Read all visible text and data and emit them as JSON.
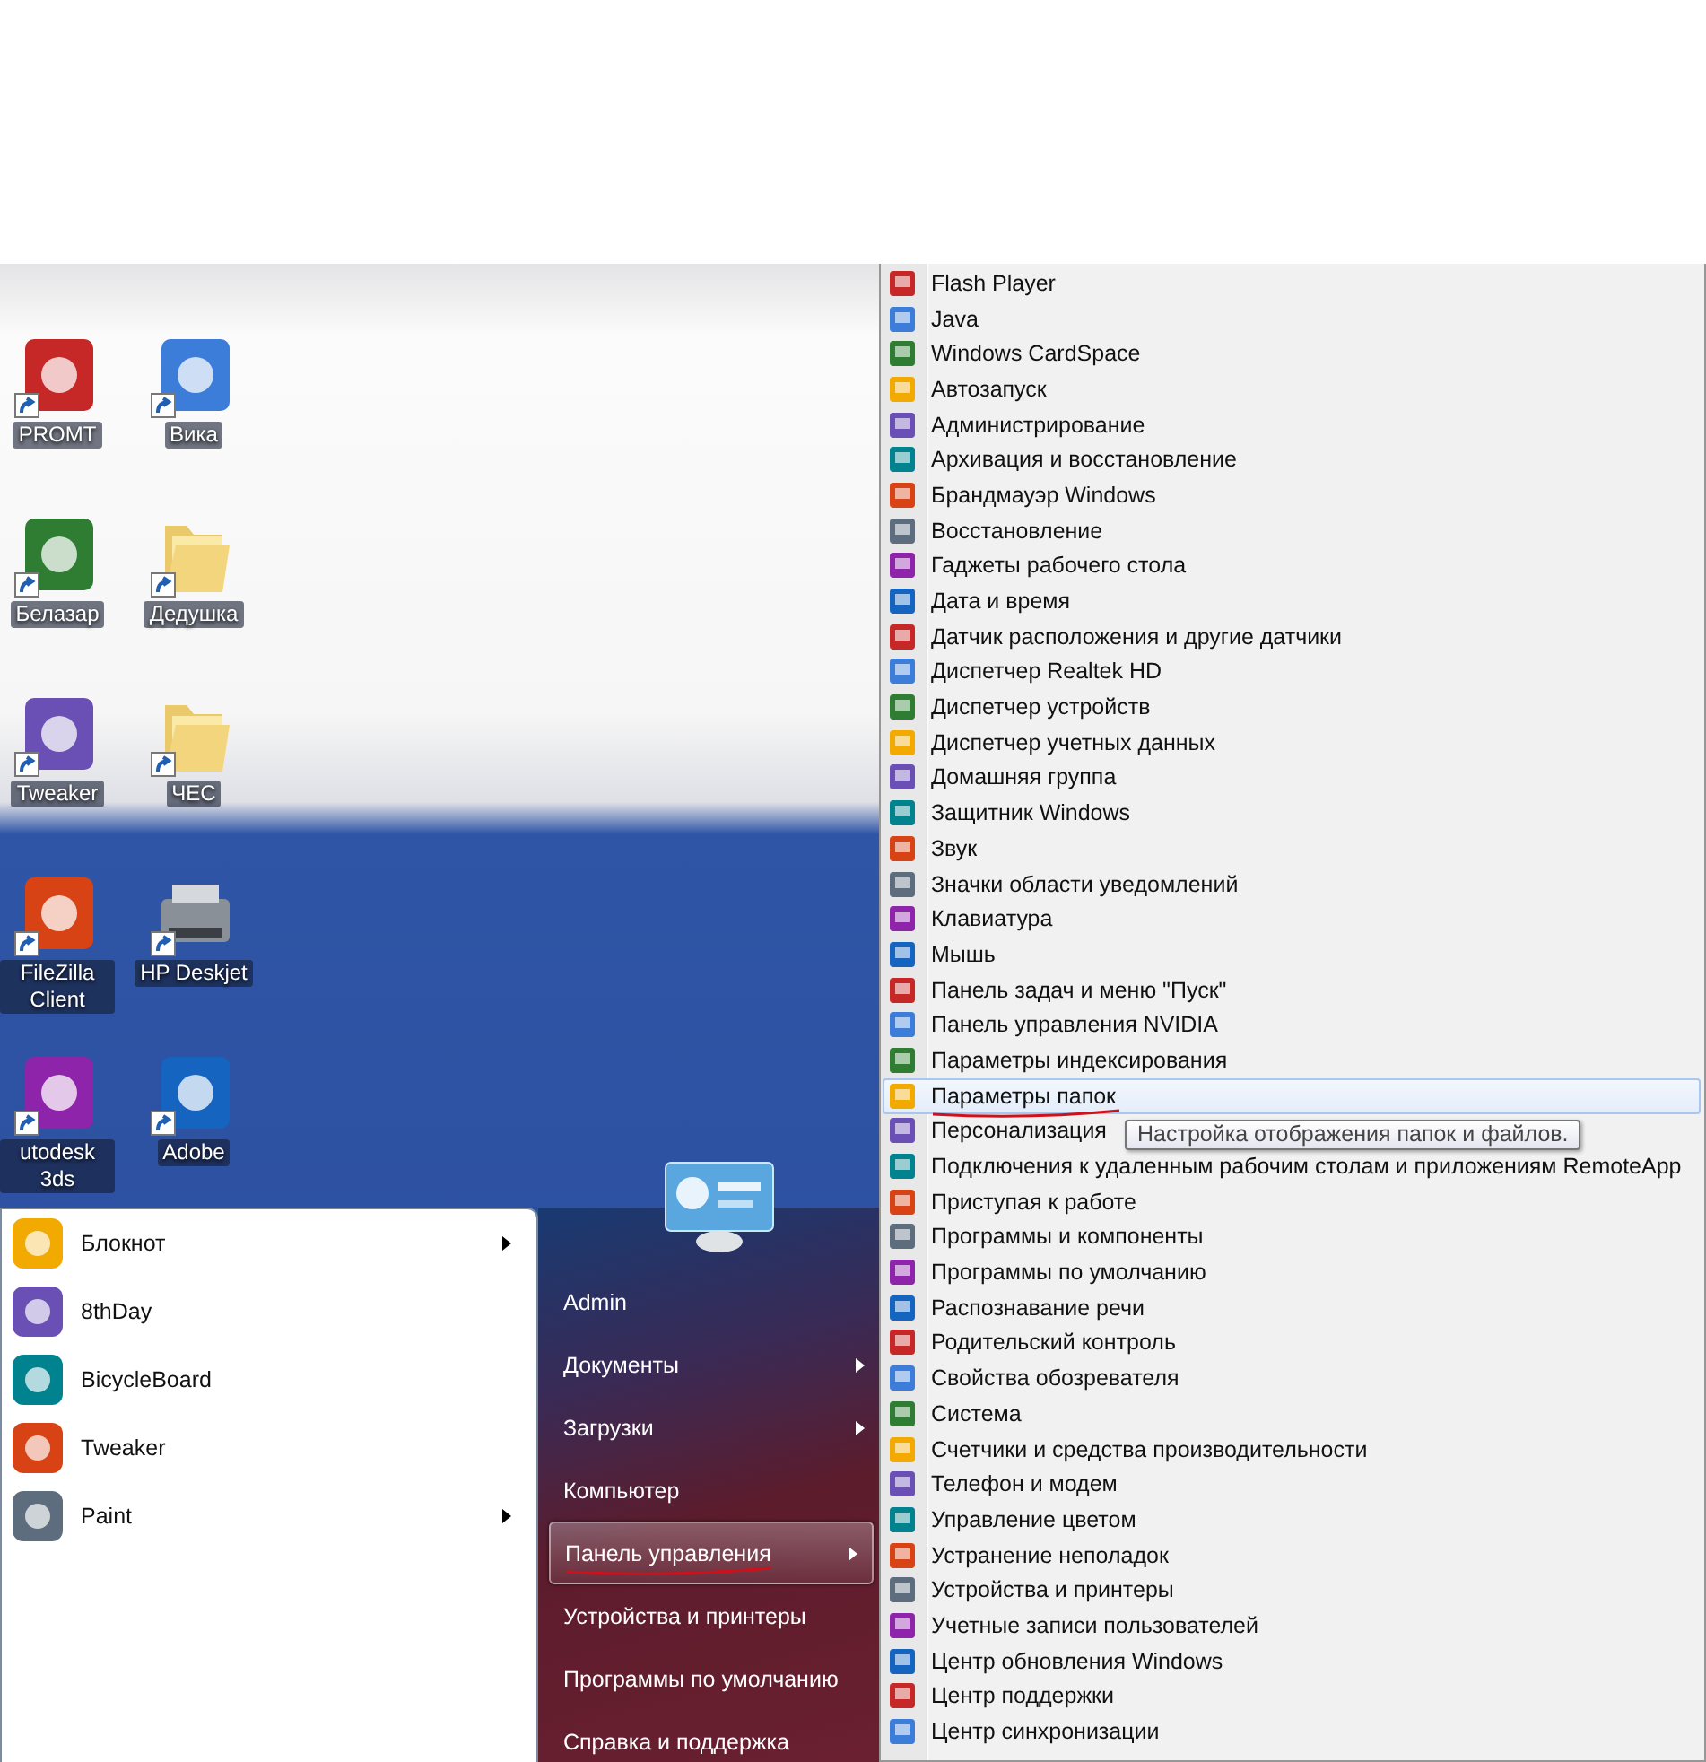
{
  "desktop": {
    "icons": [
      {
        "label": "PROMT",
        "kind": "app"
      },
      {
        "label": "Вика",
        "kind": "app"
      },
      {
        "label": "Белазар",
        "kind": "app"
      },
      {
        "label": "Дедушка",
        "kind": "folder"
      },
      {
        "label": "Tweaker",
        "kind": "app"
      },
      {
        "label": "ЧЕС",
        "kind": "folder"
      },
      {
        "label": "FileZilla Client",
        "kind": "app"
      },
      {
        "label": "HP Deskjet",
        "kind": "printer"
      },
      {
        "label": "utodesk 3ds",
        "kind": "app"
      },
      {
        "label": "Adobe",
        "kind": "app"
      }
    ]
  },
  "start_menu": {
    "programs": [
      {
        "label": "Блокнот",
        "has_submenu": true
      },
      {
        "label": "8thDay",
        "has_submenu": false
      },
      {
        "label": "BicycleBoard",
        "has_submenu": false
      },
      {
        "label": "Tweaker",
        "has_submenu": false
      },
      {
        "label": "Paint",
        "has_submenu": true
      }
    ],
    "places": [
      {
        "kind": "link",
        "label": "Admin",
        "has_submenu": false,
        "selected": false,
        "annotated": false
      },
      {
        "kind": "link",
        "label": "Документы",
        "has_submenu": true,
        "selected": false,
        "annotated": false
      },
      {
        "kind": "link",
        "label": "Загрузки",
        "has_submenu": true,
        "selected": false,
        "annotated": false
      },
      {
        "kind": "separator"
      },
      {
        "kind": "link",
        "label": "Компьютер",
        "has_submenu": false,
        "selected": false,
        "annotated": false
      },
      {
        "kind": "separator"
      },
      {
        "kind": "link",
        "label": "Панель управления",
        "has_submenu": true,
        "selected": true,
        "annotated": true
      },
      {
        "kind": "link",
        "label": "Устройства и принтеры",
        "has_submenu": false,
        "selected": false,
        "annotated": false
      },
      {
        "kind": "link",
        "label": "Программы по умолчанию",
        "has_submenu": false,
        "selected": false,
        "annotated": false
      },
      {
        "kind": "link",
        "label": "Справка и поддержка",
        "has_submenu": false,
        "selected": false,
        "annotated": false
      }
    ]
  },
  "control_panel_menu": {
    "items": [
      {
        "label": "Flash Player",
        "selected": false,
        "annotated": false
      },
      {
        "label": "Java",
        "selected": false,
        "annotated": false
      },
      {
        "label": "Windows CardSpace",
        "selected": false,
        "annotated": false
      },
      {
        "label": "Автозапуск",
        "selected": false,
        "annotated": false
      },
      {
        "label": "Администрирование",
        "selected": false,
        "annotated": false
      },
      {
        "label": "Архивация и восстановление",
        "selected": false,
        "annotated": false
      },
      {
        "label": "Брандмауэр Windows",
        "selected": false,
        "annotated": false
      },
      {
        "label": "Восстановление",
        "selected": false,
        "annotated": false
      },
      {
        "label": "Гаджеты рабочего стола",
        "selected": false,
        "annotated": false
      },
      {
        "label": "Дата и время",
        "selected": false,
        "annotated": false
      },
      {
        "label": "Датчик расположения и другие датчики",
        "selected": false,
        "annotated": false
      },
      {
        "label": "Диспетчер Realtek HD",
        "selected": false,
        "annotated": false
      },
      {
        "label": "Диспетчер устройств",
        "selected": false,
        "annotated": false
      },
      {
        "label": "Диспетчер учетных данных",
        "selected": false,
        "annotated": false
      },
      {
        "label": "Домашняя группа",
        "selected": false,
        "annotated": false
      },
      {
        "label": "Защитник Windows",
        "selected": false,
        "annotated": false
      },
      {
        "label": "Звук",
        "selected": false,
        "annotated": false
      },
      {
        "label": "Значки области уведомлений",
        "selected": false,
        "annotated": false
      },
      {
        "label": "Клавиатура",
        "selected": false,
        "annotated": false
      },
      {
        "label": "Мышь",
        "selected": false,
        "annotated": false
      },
      {
        "label": "Панель задач и меню \"Пуск\"",
        "selected": false,
        "annotated": false
      },
      {
        "label": "Панель управления NVIDIA",
        "selected": false,
        "annotated": false
      },
      {
        "label": "Параметры индексирования",
        "selected": false,
        "annotated": false
      },
      {
        "label": "Параметры папок",
        "selected": true,
        "annotated": true
      },
      {
        "label": "Персонализация",
        "selected": false,
        "annotated": false
      },
      {
        "label": "Подключения к удаленным рабочим столам и приложениям RemoteApp",
        "selected": false,
        "annotated": false
      },
      {
        "label": "Приступая к работе",
        "selected": false,
        "annotated": false
      },
      {
        "label": "Программы и компоненты",
        "selected": false,
        "annotated": false
      },
      {
        "label": "Программы по умолчанию",
        "selected": false,
        "annotated": false
      },
      {
        "label": "Распознавание речи",
        "selected": false,
        "annotated": false
      },
      {
        "label": "Родительский контроль",
        "selected": false,
        "annotated": false
      },
      {
        "label": "Свойства обозревателя",
        "selected": false,
        "annotated": false
      },
      {
        "label": "Система",
        "selected": false,
        "annotated": false
      },
      {
        "label": "Счетчики и средства производительности",
        "selected": false,
        "annotated": false
      },
      {
        "label": "Телефон и модем",
        "selected": false,
        "annotated": false
      },
      {
        "label": "Управление цветом",
        "selected": false,
        "annotated": false
      },
      {
        "label": "Устранение неполадок",
        "selected": false,
        "annotated": false
      },
      {
        "label": "Устройства и принтеры",
        "selected": false,
        "annotated": false
      },
      {
        "label": "Учетные записи пользователей",
        "selected": false,
        "annotated": false
      },
      {
        "label": "Центр обновления Windows",
        "selected": false,
        "annotated": false
      },
      {
        "label": "Центр поддержки",
        "selected": false,
        "annotated": false
      },
      {
        "label": "Центр синхронизации",
        "selected": false,
        "annotated": false
      }
    ],
    "tooltip": "Настройка отображения папок и файлов."
  }
}
